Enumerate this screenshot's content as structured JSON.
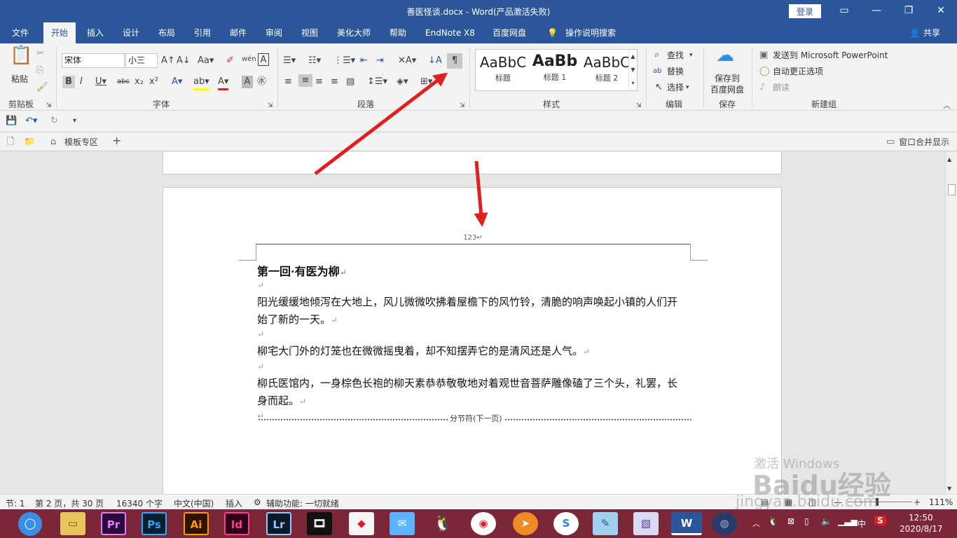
{
  "window": {
    "title": "善医怪谈.docx  -  Word(产品激活失败)",
    "login_label": "登录",
    "share_label": "共享"
  },
  "tabs": [
    "文件",
    "开始",
    "插入",
    "设计",
    "布局",
    "引用",
    "邮件",
    "审阅",
    "视图",
    "美化大师",
    "帮助",
    "EndNote X8",
    "百度网盘"
  ],
  "tell_me": "操作说明搜索",
  "ribbon": {
    "clipboard": {
      "paste_label": "粘贴",
      "group_label": "剪贴板"
    },
    "font": {
      "font_name": "宋体",
      "font_size": "小三",
      "group_label": "字体"
    },
    "paragraph": {
      "group_label": "段落"
    },
    "styles": {
      "items": [
        {
          "sample": "AaBbC",
          "name": "标题"
        },
        {
          "sample": "AaBb",
          "name": "标题 1"
        },
        {
          "sample": "AaBbC",
          "name": "标题 2"
        }
      ],
      "group_label": "样式"
    },
    "editing": {
      "find_label": "查找",
      "replace_label": "替换",
      "select_label": "选择",
      "group_label": "编辑"
    },
    "save": {
      "label_line1": "保存到",
      "label_line2": "百度网盘",
      "group_label": "保存"
    },
    "new_group": {
      "send_ppt": "发送到 Microsoft PowerPoint",
      "auto_update": "自动更正选项",
      "read_aloud": "朗读",
      "group_label": "新建组"
    }
  },
  "doc_tabs": {
    "template_label": "模板专区",
    "merge_label": "窗口合并显示"
  },
  "document": {
    "header_text": "123",
    "title": "第一回·有医为柳",
    "lines": [
      "阳光缓缓地倾泻在大地上，风儿微微吹拂着屋檐下的风竹铃，清脆的响声唤起小镇的人们开",
      "始了新的一天。",
      "柳宅大门外的灯笼也在微微摇曳着，却不知摆弄它的是清风还是人气。",
      "柳氏医馆内，一身棕色长袍的柳天素恭恭敬敬地对着观世音菩萨雕像磕了三个头，礼罢，长",
      "身而起。"
    ],
    "section_break": "分节符(下一页)",
    "para_mark": "↵"
  },
  "statusbar": {
    "section": "节: 1",
    "page": "第 2 页，共 30 页",
    "words": "16340 个字",
    "language": "中文(中国)",
    "mode": "插入",
    "accessibility": "辅助功能: 一切就绪",
    "zoom": "111%"
  },
  "taskbar": {
    "apps": [
      "Pr",
      "Ps",
      "Ai",
      "Id",
      "Lr"
    ],
    "time": "12:50",
    "date": "2020/8/17",
    "ime": "中"
  },
  "watermark": {
    "line1": "激活 Windows",
    "brand": "Baidu经验",
    "url": "jingyan.baidu.com"
  },
  "colors": {
    "word_blue": "#2b579a",
    "arrow_red": "#e02020",
    "taskbar": "#7b2738"
  }
}
